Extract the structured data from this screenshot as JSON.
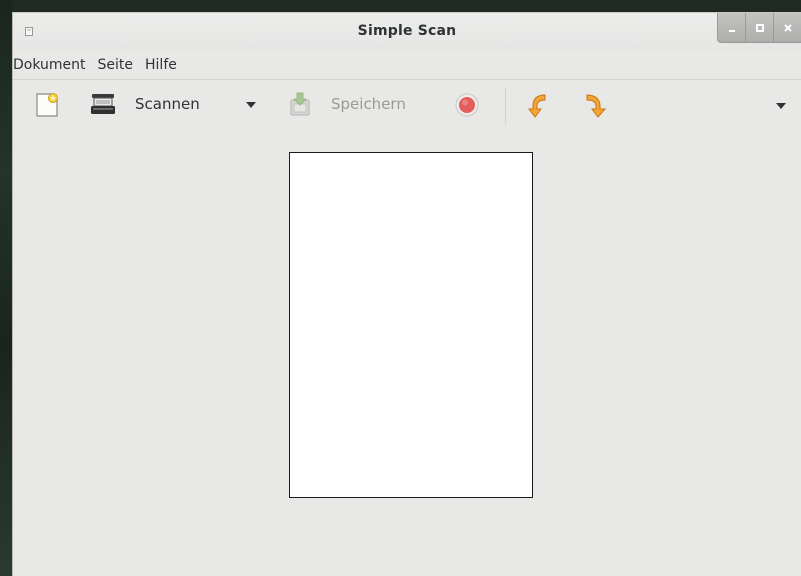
{
  "window": {
    "title": "Simple Scan"
  },
  "menubar": {
    "items": [
      {
        "label": "Dokument"
      },
      {
        "label": "Seite"
      },
      {
        "label": "Hilfe"
      }
    ]
  },
  "toolbar": {
    "new_icon": "new-document-icon",
    "scanner_icon": "scanner-icon",
    "scan_label": "Scannen",
    "save_label": "Speichern",
    "save_disabled": true,
    "stop_icon": "stop-icon",
    "rotate_left_icon": "rotate-left-icon",
    "rotate_right_icon": "rotate-right-icon"
  },
  "colors": {
    "window_bg": "#e8e8e7",
    "accent_orange": "#f0a030",
    "stop_red": "#e05a5a"
  }
}
